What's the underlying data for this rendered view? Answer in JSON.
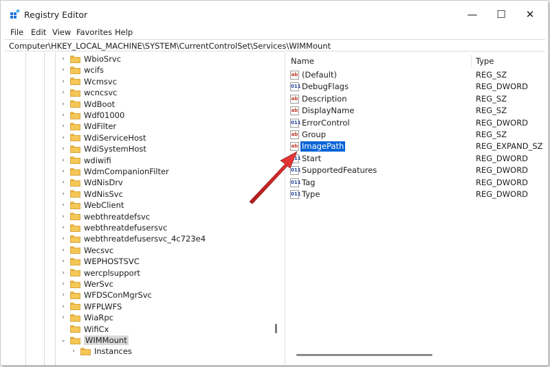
{
  "window": {
    "title": "Registry Editor",
    "min_glyph": "—",
    "max_glyph": "☐",
    "close_glyph": "✕"
  },
  "menu": [
    "File",
    "Edit",
    "View",
    "Favorites",
    "Help"
  ],
  "address": "Computer\\HKEY_LOCAL_MACHINE\\SYSTEM\\CurrentControlSet\\Services\\WIMMount",
  "tree": [
    {
      "label": "WbioSrvc",
      "expander": "›"
    },
    {
      "label": "wcifs",
      "expander": "›"
    },
    {
      "label": "Wcmsvc",
      "expander": "›"
    },
    {
      "label": "wcncsvc",
      "expander": "›"
    },
    {
      "label": "WdBoot",
      "expander": "›"
    },
    {
      "label": "Wdf01000",
      "expander": "›"
    },
    {
      "label": "WdFilter",
      "expander": "›"
    },
    {
      "label": "WdiServiceHost",
      "expander": "›"
    },
    {
      "label": "WdiSystemHost",
      "expander": "›"
    },
    {
      "label": "wdiwifi",
      "expander": "›"
    },
    {
      "label": "WdmCompanionFilter",
      "expander": "›"
    },
    {
      "label": "WdNisDrv",
      "expander": "›"
    },
    {
      "label": "WdNisSvc",
      "expander": "›"
    },
    {
      "label": "WebClient",
      "expander": "›"
    },
    {
      "label": "webthreatdefsvc",
      "expander": "›"
    },
    {
      "label": "webthreatdefusersvc",
      "expander": "›"
    },
    {
      "label": "webthreatdefusersvc_4c723e4",
      "expander": "›"
    },
    {
      "label": "Wecsvc",
      "expander": "›"
    },
    {
      "label": "WEPHOSTSVC",
      "expander": "›"
    },
    {
      "label": "wercplsupport",
      "expander": "›"
    },
    {
      "label": "WerSvc",
      "expander": "›"
    },
    {
      "label": "WFDSConMgrSvc",
      "expander": "›"
    },
    {
      "label": "WFPLWFS",
      "expander": "›"
    },
    {
      "label": "WiaRpc",
      "expander": "›"
    },
    {
      "label": "WifiCx",
      "expander": ""
    },
    {
      "label": "WIMMount",
      "expander": "⌄",
      "selected": true
    },
    {
      "label": "Instances",
      "expander": "›",
      "child": true
    }
  ],
  "list": {
    "columns": {
      "name": "Name",
      "type": "Type"
    },
    "values": [
      {
        "name": "(Default)",
        "type": "REG_SZ",
        "icon": "ab",
        "kind": "sz"
      },
      {
        "name": "DebugFlags",
        "type": "REG_DWORD",
        "icon": "011",
        "kind": "dw"
      },
      {
        "name": "Description",
        "type": "REG_SZ",
        "icon": "ab",
        "kind": "sz"
      },
      {
        "name": "DisplayName",
        "type": "REG_SZ",
        "icon": "ab",
        "kind": "sz"
      },
      {
        "name": "ErrorControl",
        "type": "REG_DWORD",
        "icon": "011",
        "kind": "dw"
      },
      {
        "name": "Group",
        "type": "REG_SZ",
        "icon": "ab",
        "kind": "sz"
      },
      {
        "name": "ImagePath",
        "type": "REG_EXPAND_SZ",
        "icon": "ab",
        "kind": "sz",
        "selected": true
      },
      {
        "name": "Start",
        "type": "REG_DWORD",
        "icon": "011",
        "kind": "dw"
      },
      {
        "name": "SupportedFeatures",
        "type": "REG_DWORD",
        "icon": "011",
        "kind": "dw"
      },
      {
        "name": "Tag",
        "type": "REG_DWORD",
        "icon": "011",
        "kind": "dw"
      },
      {
        "name": "Type",
        "type": "REG_DWORD",
        "icon": "011",
        "kind": "dw"
      }
    ]
  },
  "colors": {
    "selection": "#0a64d6",
    "arrow": "#d8232a",
    "folder": "#f5c757"
  }
}
